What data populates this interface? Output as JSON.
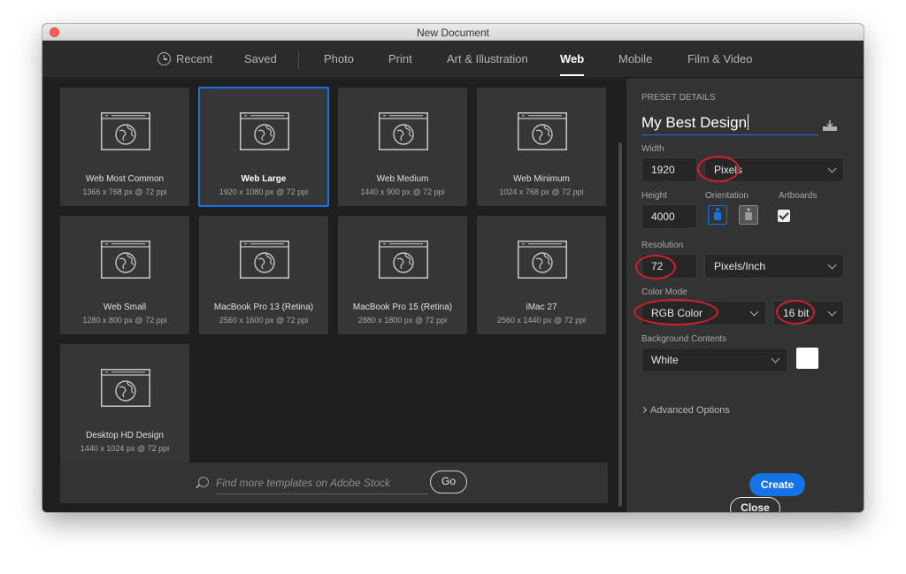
{
  "window": {
    "title": "New Document"
  },
  "tabs": [
    {
      "label": "Recent",
      "icon": "clock-icon"
    },
    {
      "label": "Saved"
    },
    {
      "label": "Photo"
    },
    {
      "label": "Print"
    },
    {
      "label": "Art & Illustration"
    },
    {
      "label": "Web",
      "active": true
    },
    {
      "label": "Mobile"
    },
    {
      "label": "Film & Video"
    }
  ],
  "presets": [
    {
      "name": "Web Most Common",
      "dims": "1366 x 768 px @ 72 ppi"
    },
    {
      "name": "Web Large",
      "dims": "1920 x 1080 px @ 72 ppi",
      "selected": true
    },
    {
      "name": "Web Medium",
      "dims": "1440 x 900 px @ 72 ppi"
    },
    {
      "name": "Web Minimum",
      "dims": "1024 x 768 px @ 72 ppi"
    },
    {
      "name": "Web Small",
      "dims": "1280 x 800 px @ 72 ppi"
    },
    {
      "name": "MacBook Pro 13 (Retina)",
      "dims": "2560 x 1600 px @ 72 ppi"
    },
    {
      "name": "MacBook Pro 15 (Retina)",
      "dims": "2880 x 1800 px @ 72 ppi"
    },
    {
      "name": "iMac 27",
      "dims": "2560 x 1440 px @ 72 ppi"
    },
    {
      "name": "Desktop HD Design",
      "dims": "1440 x 1024 px @ 72 ppi"
    }
  ],
  "stock": {
    "placeholder": "Find more templates on Adobe Stock",
    "go_label": "Go"
  },
  "preset_details": {
    "heading": "PRESET DETAILS",
    "document_name": "My Best Design",
    "width_label": "Width",
    "width_value": "1920",
    "width_unit": "Pixels",
    "height_label": "Height",
    "height_value": "4000",
    "orientation_label": "Orientation",
    "artboards_label": "Artboards",
    "artboards_checked": true,
    "resolution_label": "Resolution",
    "resolution_value": "72",
    "resolution_unit": "Pixels/Inch",
    "color_mode_label": "Color Mode",
    "color_mode_value": "RGB Color",
    "bit_depth_value": "16 bit",
    "background_label": "Background Contents",
    "background_value": "White",
    "advanced_label": "Advanced Options"
  },
  "buttons": {
    "close_label": "Close",
    "create_label": "Create"
  },
  "colors": {
    "accent": "#1473e6",
    "annotation": "#d61f26",
    "panel": "#333333",
    "grid": "#1f1f1f"
  }
}
